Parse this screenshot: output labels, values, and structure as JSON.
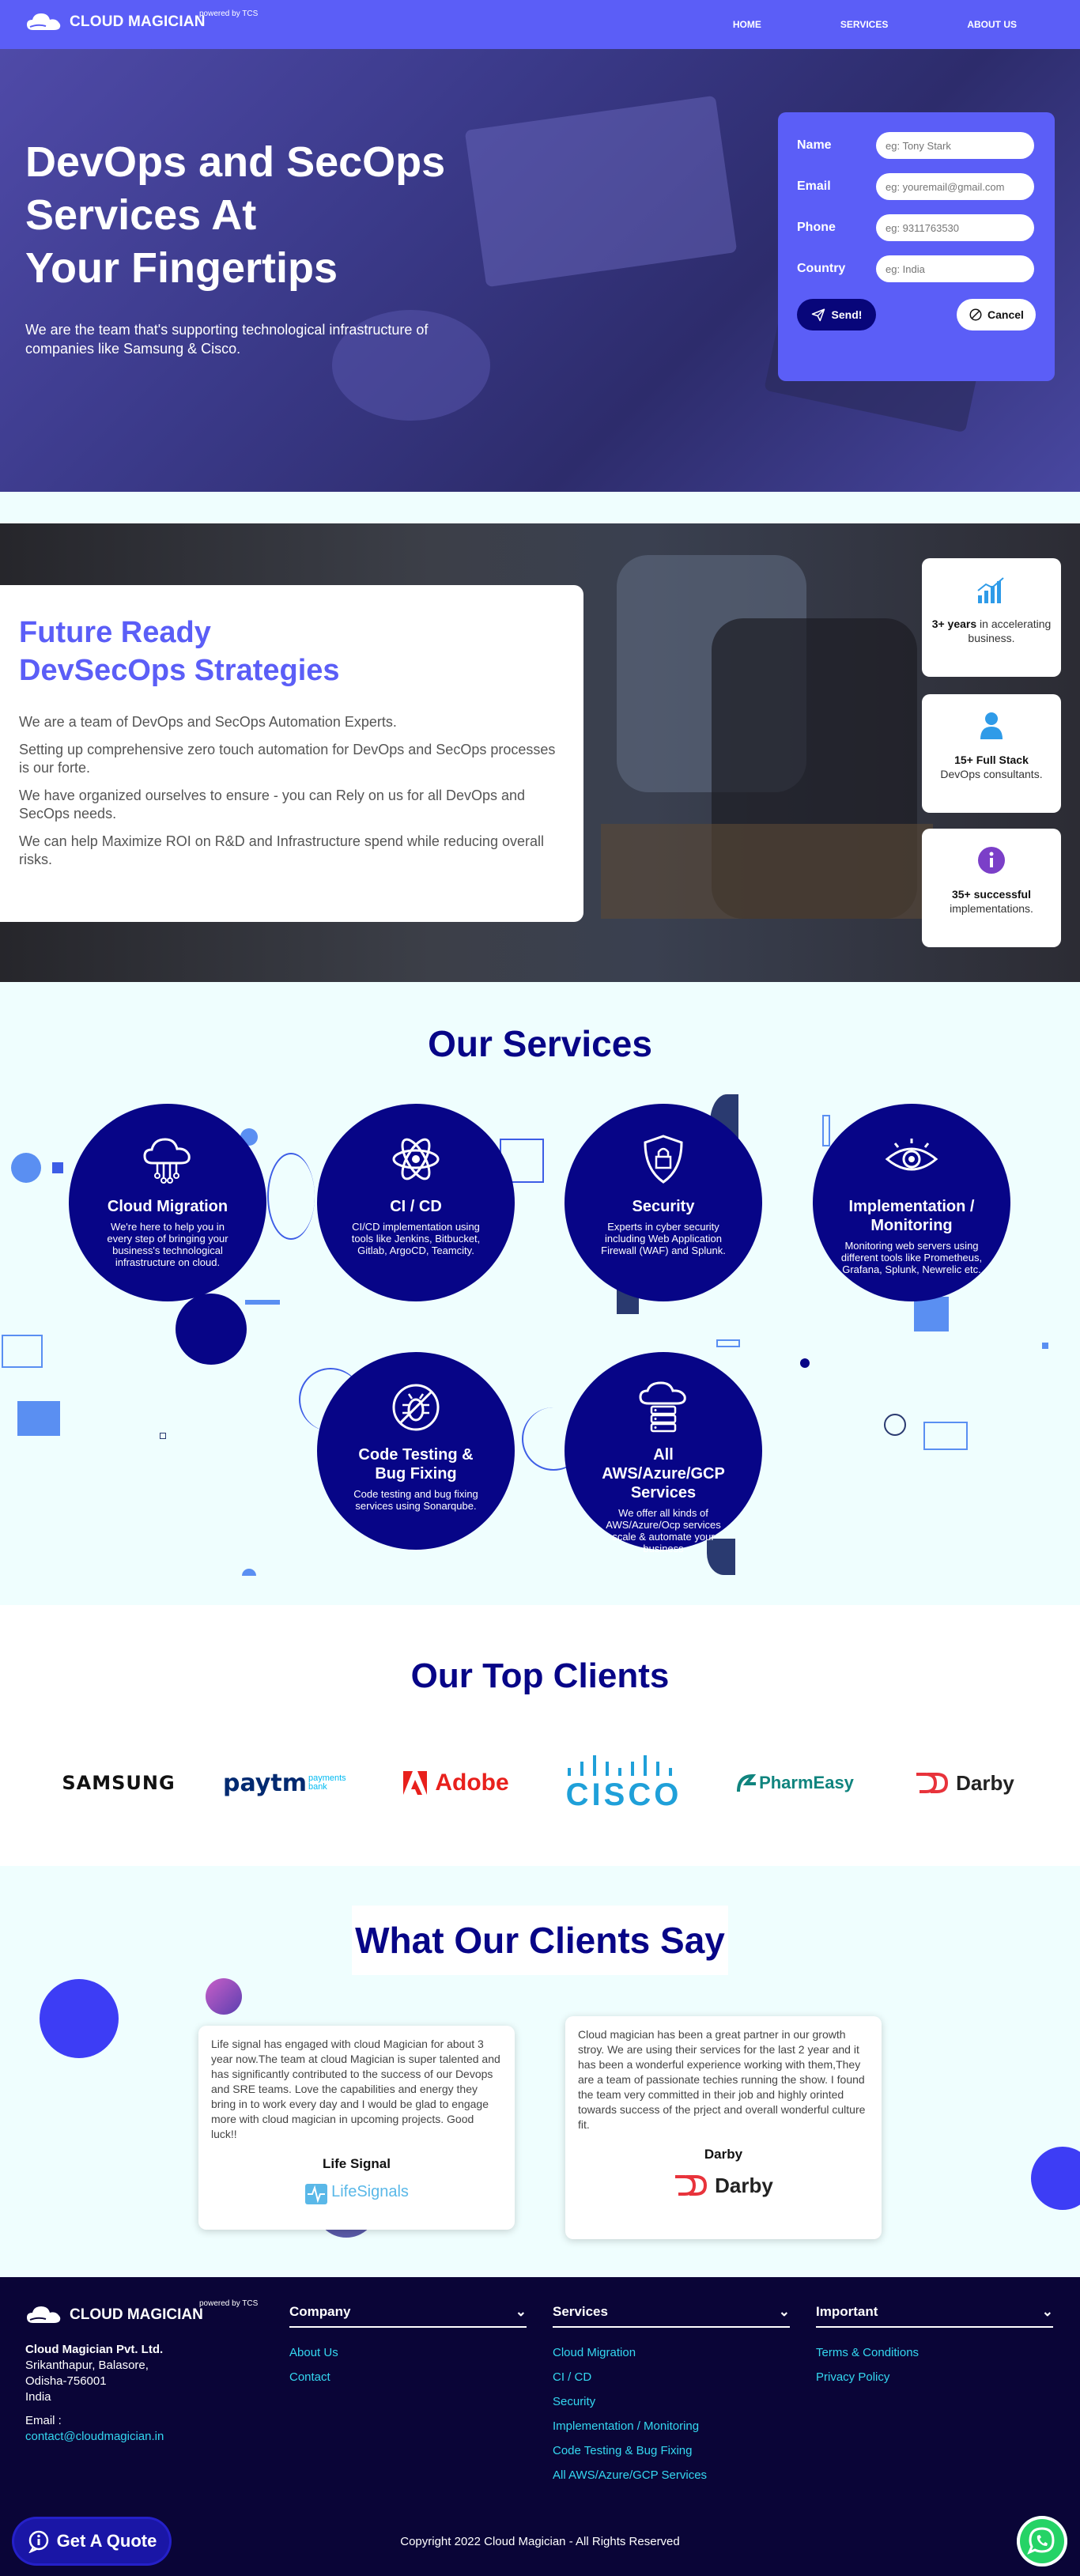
{
  "header": {
    "brand": "CLOUD MAGICIAN",
    "powered": "powered by TCS",
    "nav": [
      "HOME",
      "SERVICES",
      "ABOUT US"
    ]
  },
  "hero": {
    "title_lines": [
      "DevOps and SecOps",
      "Services At",
      "Your Fingertips"
    ],
    "subtitle": "We are the team that's supporting technological infrastructure of companies like Samsung & Cisco."
  },
  "form": {
    "fields": [
      {
        "label": "Name",
        "placeholder": "eg: Tony Stark"
      },
      {
        "label": "Email",
        "placeholder": "eg: youremail@gmail.com"
      },
      {
        "label": "Phone",
        "placeholder": "eg: 9311763530"
      },
      {
        "label": "Country",
        "placeholder": "eg: India"
      }
    ],
    "send_label": "Send!",
    "cancel_label": "Cancel"
  },
  "future": {
    "title_lines": [
      "Future Ready",
      "DevSecOps Strategies"
    ],
    "paragraphs": [
      "We are a team of DevOps and SecOps Automation Experts.",
      "Setting up comprehensive zero touch automation for DevOps and SecOps processes is our forte.",
      "We have organized ourselves to ensure - you can Rely on us for all DevOps and SecOps needs.",
      "We can help Maximize ROI on R&D and Infrastructure spend while reducing overall risks."
    ],
    "stats": [
      {
        "bold": "3+ years",
        "rest": " in accelerating business."
      },
      {
        "bold": "15+ Full Stack",
        "rest": " DevOps consultants."
      },
      {
        "bold": "35+ successful",
        "rest": " implementations."
      }
    ]
  },
  "services": {
    "title": "Our Services",
    "items": [
      {
        "title": "Cloud Migration",
        "desc": "We're here to help you in every step of bringing your business's technological infrastructure on cloud.",
        "icon": "cloud-circuit-icon"
      },
      {
        "title": "CI / CD",
        "desc": "CI/CD implementation using tools like Jenkins, Bitbucket, Gitlab, ArgoCD, Teamcity.",
        "icon": "atom-icon"
      },
      {
        "title": "Security",
        "desc": "Experts in cyber security including Web Application Firewall (WAF) and Splunk.",
        "icon": "shield-lock-icon"
      },
      {
        "title": "Implementation / Monitoring",
        "desc": "Monitoring web servers using different tools like Prometheus, Grafana, Splunk, Newrelic etc.",
        "icon": "eye-icon"
      },
      {
        "title": "Code Testing & Bug Fixing",
        "desc": "Code testing and bug fixing services using Sonarqube.",
        "icon": "bug-icon"
      },
      {
        "title": "All AWS/Azure/GCP Services",
        "desc": "We offer all kinds of AWS/Azure/Ocp services scale & automate your business",
        "icon": "cloud-server-icon"
      }
    ]
  },
  "clients": {
    "title": "Our Top Clients",
    "logos": [
      {
        "name": "SAMSUNG"
      },
      {
        "name": "paytm",
        "extra": "payments bank"
      },
      {
        "name": "Adobe"
      },
      {
        "name": "CISCO"
      },
      {
        "name": "PharmEasy"
      },
      {
        "name": "Darby"
      }
    ]
  },
  "testimonials": {
    "title": "What Our Clients Say",
    "items": [
      {
        "text": "Life signal has engaged with cloud Magician for about 3 year now.The team at cloud Magician is super talented and has significantly contributed to the success of our Devops and SRE teams. Love the capabilities and energy they bring in to work every day and I would be glad to engage more with cloud magician in upcoming projects. Good luck!!",
        "name": "Life Signal",
        "logo": "LifeSignals"
      },
      {
        "text": "Cloud magician has been a great partner in our growth stroy. We are using their services for the last 2 year and it has been a wonderful experience working with them,They are a team of passionate techies running the show. I found the team very committed in their job and highly orinted towards success of the prject and overall wonderful culture fit.",
        "name": "Darby",
        "logo": "Darby"
      }
    ]
  },
  "footer": {
    "brand": "CLOUD MAGICIAN",
    "powered": "powered by TCS",
    "company_name": "Cloud Magician Pvt. Ltd.",
    "address_lines": [
      "Srikanthapur, Balasore,",
      "Odisha-756001",
      "India"
    ],
    "email_label": "Email :",
    "email": "contact@cloudmagician.in",
    "columns": [
      {
        "title": "Company",
        "links": [
          "About Us",
          "Contact"
        ]
      },
      {
        "title": "Services",
        "links": [
          "Cloud Migration",
          "CI / CD",
          "Security",
          "Implementation / Monitoring",
          "Code Testing & Bug Fixing",
          "All AWS/Azure/GCP Services"
        ]
      },
      {
        "title": "Important",
        "links": [
          "Terms & Conditions",
          "Privacy Policy"
        ]
      }
    ],
    "copyright": "Copyright 2022 Cloud Magician - All Rights Reserved",
    "quote_button": "Get A Quote"
  },
  "colors": {
    "primary": "#5b5ef7",
    "navy": "#070587",
    "footer": "#0a0537",
    "link": "#34d8f0"
  }
}
